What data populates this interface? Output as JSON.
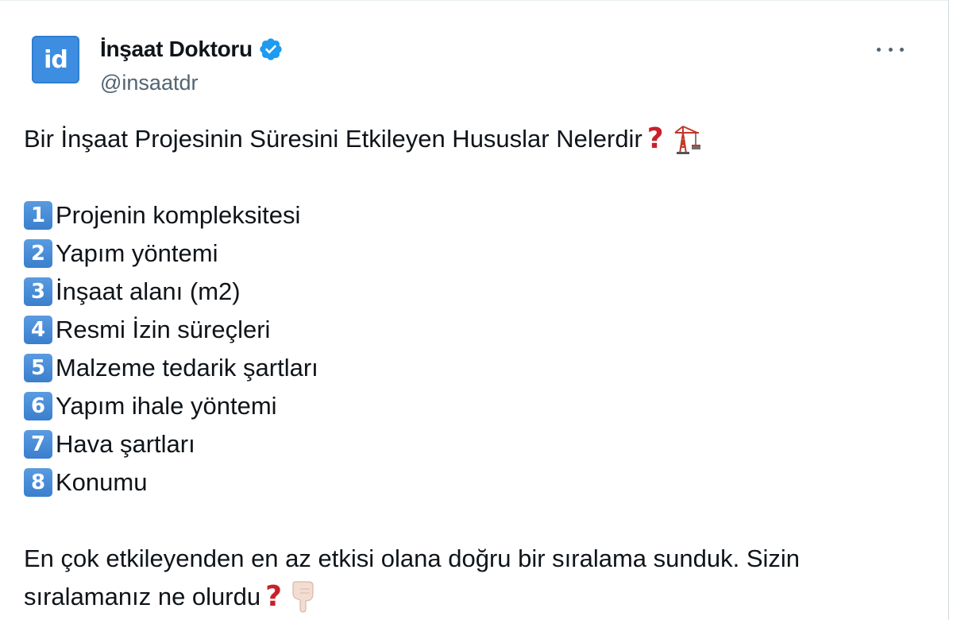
{
  "account": {
    "avatar_text": "id",
    "display_name": "İnşaat Doktoru",
    "handle": "@insaatdr",
    "verified": true
  },
  "tweet": {
    "title": "Bir İnşaat Projesinin Süresini Etkileyen Hususlar Nelerdir",
    "items": [
      {
        "num": "1",
        "text": "Projenin kompleksitesi"
      },
      {
        "num": "2",
        "text": "Yapım yöntemi"
      },
      {
        "num": "3",
        "text": "İnşaat alanı (m2)"
      },
      {
        "num": "4",
        "text": "Resmi İzin süreçleri"
      },
      {
        "num": "5",
        "text": "Malzeme tedarik şartları"
      },
      {
        "num": "6",
        "text": "Yapım ihale yöntemi"
      },
      {
        "num": "7",
        "text": "Hava şartları"
      },
      {
        "num": "8",
        "text": "Konumu"
      }
    ],
    "closing_line1": "En çok etkileyenden en az etkisi olana doğru bir sıralama sunduk. Sizin",
    "closing_line2": "sıralamanız ne olurdu"
  },
  "icons": {
    "question": "question-mark-icon",
    "crane": "construction-crane-icon",
    "pointing_down": "pointing-down-hand-icon",
    "verified": "verified-badge-icon",
    "more": "more-options-icon"
  },
  "colors": {
    "verified_blue": "#1d9bf0",
    "avatar_blue": "#3d8ee0",
    "keycap_blue": "#4a8fd8",
    "question_red": "#c9202a",
    "secondary_text": "#536471"
  }
}
